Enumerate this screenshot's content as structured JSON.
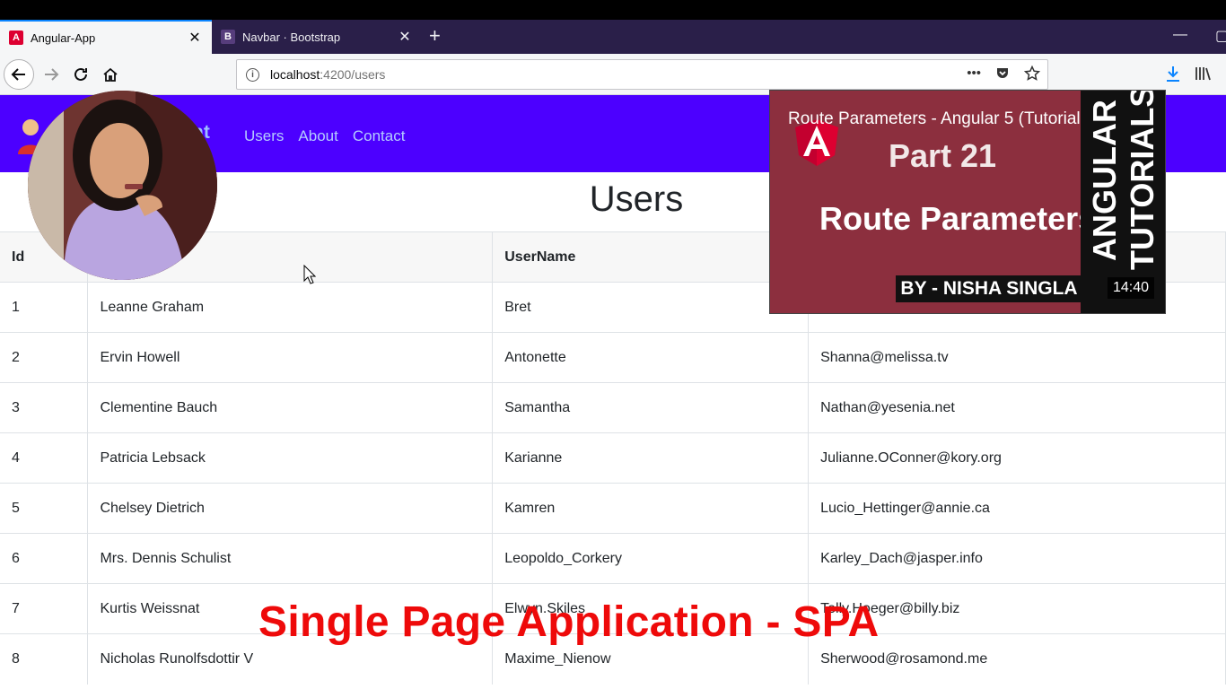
{
  "browser": {
    "tabs": [
      {
        "title": "Angular-App",
        "icon": "angular-icon",
        "close": "✕"
      },
      {
        "title": "Navbar · Bootstrap",
        "icon": "bootstrap-icon",
        "close": "✕"
      }
    ],
    "new_tab": "+",
    "url_host": "localhost",
    "url_path": ":4200/users",
    "url_actions": [
      "more-icon",
      "pocket-icon",
      "star-icon"
    ],
    "toolbar_right": [
      "download-icon",
      "library-icon"
    ]
  },
  "app": {
    "brand": "nt",
    "nav_links": [
      "Users",
      "About",
      "Contact"
    ],
    "page_title": "Users",
    "table": {
      "headers": [
        "Id",
        "",
        "UserName",
        ""
      ],
      "rows": [
        [
          "1",
          "Leanne Graham",
          "Bret",
          ""
        ],
        [
          "2",
          "Ervin Howell",
          "Antonette",
          "Shanna@melissa.tv"
        ],
        [
          "3",
          "Clementine Bauch",
          "Samantha",
          "Nathan@yesenia.net"
        ],
        [
          "4",
          "Patricia Lebsack",
          "Karianne",
          "Julianne.OConner@kory.org"
        ],
        [
          "5",
          "Chelsey Dietrich",
          "Kamren",
          "Lucio_Hettinger@annie.ca"
        ],
        [
          "6",
          "Mrs. Dennis Schulist",
          "Leopoldo_Corkery",
          "Karley_Dach@jasper.info"
        ],
        [
          "7",
          "Kurtis Weissnat",
          "Elwyn.Skiles",
          "Telly.Hoeger@billy.biz"
        ],
        [
          "8",
          "Nicholas Runolfsdottir V",
          "Maxime_Nienow",
          "Sherwood@rosamond.me"
        ]
      ]
    }
  },
  "video": {
    "title": "Route Parameters - Angular 5 (Tutorial #21)",
    "part": "Part  21",
    "heading": "Route Parameters",
    "byline": "BY - NISHA SINGLA",
    "duration": "14:40",
    "side_1": "ANGULAR",
    "side_2": "TUTORIALS"
  },
  "caption": "Single Page Application - SPA",
  "colors": {
    "app_nav": "#4c00ff",
    "caption": "#ee0a0a",
    "video_bg": "#8c2f3e"
  }
}
